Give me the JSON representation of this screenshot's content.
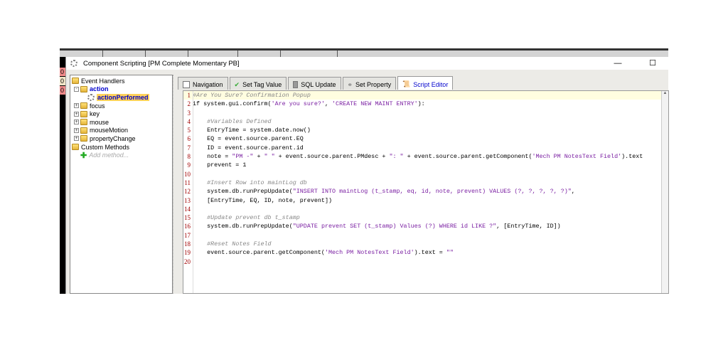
{
  "background": {
    "cells": [
      "0",
      "0",
      "0"
    ]
  },
  "window": {
    "title": "Component Scripting [PM Complete Momentary PB]",
    "minimize": "—",
    "maximize": "☐"
  },
  "tree": {
    "event_handlers": "Event Handlers",
    "action": "action",
    "action_performed": "actionPerformed",
    "items": [
      "focus",
      "key",
      "mouse",
      "mouseMotion",
      "propertyChange"
    ],
    "custom_methods": "Custom Methods",
    "add_method": "Add method..."
  },
  "tabs": [
    "Navigation",
    "Set Tag Value",
    "SQL Update",
    "Set Property",
    "Script Editor"
  ],
  "active_tab": "Script Editor",
  "code": [
    "#Are You Sure? Confirmation Popup",
    "if system.gui.confirm('Are you sure?', 'CREATE NEW MAINT ENTRY'):",
    "",
    "    #Variables Defined",
    "    EntryTime = system.date.now()",
    "    EQ = event.source.parent.EQ",
    "    ID = event.source.parent.id",
    "    note = \"PM -\" + \" \" + event.source.parent.PMdesc + \": \" + event.source.parent.getComponent('Mech PM NotesText Field').text",
    "    prevent = 1",
    "",
    "    #Insert Row into maintLog db",
    "    system.db.runPrepUpdate(\"INSERT INTO maintLog (t_stamp, eq, id, note, prevent) VALUES (?, ?, ?, ?, ?)\",",
    "    [EntryTime, EQ, ID, note, prevent])",
    "",
    "    #Update prevent db t_stamp",
    "    system.db.runPrepUpdate(\"UPDATE prevent SET (t_stamp) Values (?) WHERE id LIKE ?\", [EntryTime, ID])",
    "",
    "    #Reset Notes Field",
    "    event.source.parent.getComponent('Mech PM NotesText Field').text = \"\"",
    ""
  ]
}
